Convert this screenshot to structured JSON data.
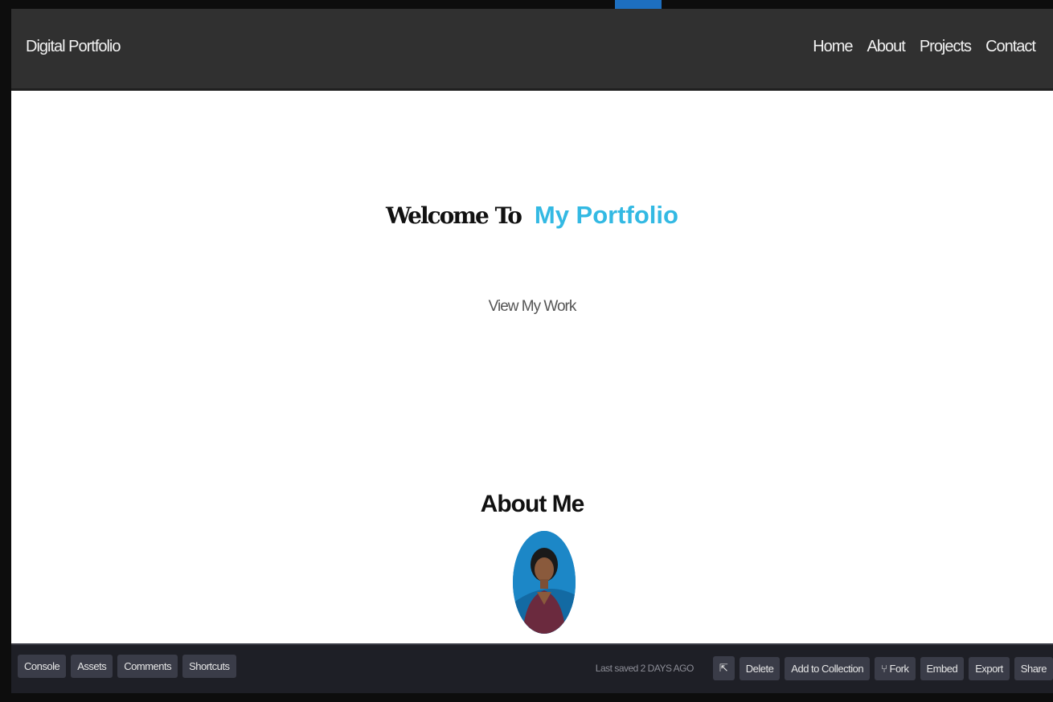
{
  "navbar": {
    "brand": "Digital Portfolio",
    "links": [
      "Home",
      "About",
      "Projects",
      "Contact"
    ]
  },
  "hero": {
    "welcome": "Welcome",
    "to": "To",
    "highlight": "My Portfolio",
    "cta": "View My Work",
    "highlight_color": "#33b9e3"
  },
  "about": {
    "title": "About Me"
  },
  "toolbar": {
    "left_buttons": [
      "Console",
      "Assets",
      "Comments",
      "Shortcuts"
    ],
    "last_saved": "Last saved 2 DAYS AGO",
    "right_buttons": [
      "Delete",
      "Add to Collection",
      "Fork",
      "Embed",
      "Export",
      "Share"
    ],
    "icons": [
      "external-link-icon",
      "fork-icon"
    ]
  }
}
